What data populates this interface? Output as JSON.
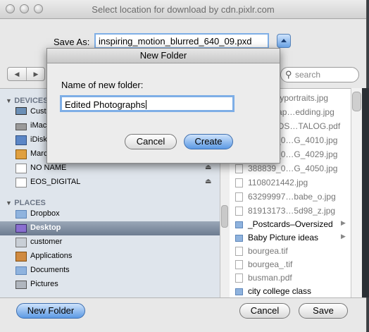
{
  "window": {
    "title": "Select location for download by cdn.pixlr.com"
  },
  "save_as": {
    "label": "Save As:",
    "value": "inspiring_motion_blurred_640_09.pxd"
  },
  "toolbar": {
    "back_glyph": "◀",
    "forward_glyph": "▶",
    "search_placeholder": "search"
  },
  "sidebar": {
    "devices_header": "DEVICES",
    "devices": [
      {
        "label": "Cust",
        "icon": "monitor-icon"
      },
      {
        "label": "iMac",
        "icon": "hard-drive-icon"
      },
      {
        "label": "iDisk",
        "icon": "idisk-icon"
      },
      {
        "label": "Marc",
        "icon": "user-disk-icon"
      },
      {
        "label": "NO NAME",
        "icon": "external-drive-icon",
        "eject": "⏏"
      },
      {
        "label": "EOS_DIGITAL",
        "icon": "external-drive-icon",
        "eject": "⏏"
      }
    ],
    "places_header": "PLACES",
    "places": [
      {
        "label": "Dropbox",
        "icon": "folder-icon"
      },
      {
        "label": "Desktop",
        "icon": "desktop-icon",
        "selected": true
      },
      {
        "label": "customer",
        "icon": "home-icon"
      },
      {
        "label": "Applications",
        "icon": "applications-icon"
      },
      {
        "label": "Documents",
        "icon": "documents-icon"
      },
      {
        "label": "Pictures",
        "icon": "pictures-icon"
      }
    ]
  },
  "files": [
    {
      "name": "75holidayportraits.jpg",
      "folder": false
    },
    {
      "name": "0418–Cap…edding.jpg",
      "folder": false
    },
    {
      "name": "2012–NOS…TALOG.pdf",
      "folder": false
    },
    {
      "name": "388839_0…G_4010.jpg",
      "folder": false
    },
    {
      "name": "388839_0…G_4029.jpg",
      "folder": false
    },
    {
      "name": "388839_0…G_4050.jpg",
      "folder": false
    },
    {
      "name": "1108021442.jpg",
      "folder": false
    },
    {
      "name": "63299997…babe_o.jpg",
      "folder": false
    },
    {
      "name": "81913173…5d98_z.jpg",
      "folder": false
    },
    {
      "name": "_Postcards–Oversized",
      "folder": true
    },
    {
      "name": "Baby Picture ideas",
      "folder": true
    },
    {
      "name": "bourgea.tif",
      "folder": false
    },
    {
      "name": "bourgea_.tif",
      "folder": false
    },
    {
      "name": "busman.pdf",
      "folder": false
    },
    {
      "name": "city college class",
      "folder": true
    }
  ],
  "buttons": {
    "new_folder": "New Folder",
    "cancel": "Cancel",
    "save": "Save"
  },
  "sheet": {
    "title": "New Folder",
    "prompt": "Name of new folder:",
    "value": "Edited Photographs",
    "cancel": "Cancel",
    "create": "Create"
  },
  "colors": {
    "accent": "#5b99e4",
    "selection": "#6d7c90"
  }
}
